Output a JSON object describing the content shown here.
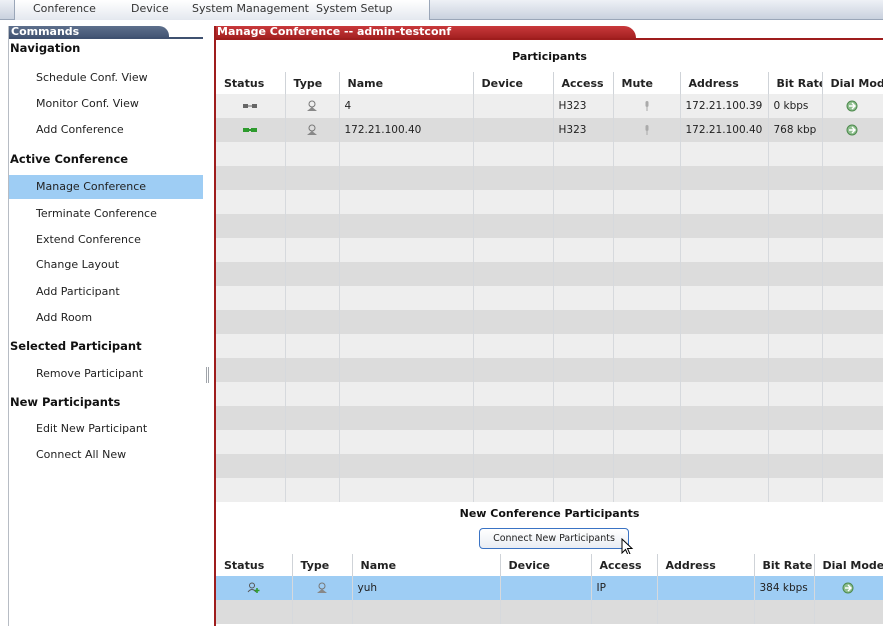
{
  "menubar": {
    "items": [
      "Conference",
      "Device",
      "System Management",
      "System Setup"
    ]
  },
  "commands": {
    "header": "Commands",
    "sections": [
      {
        "title": "Navigation",
        "items": [
          "Schedule Conf. View",
          "Monitor Conf. View",
          "Add Conference"
        ]
      },
      {
        "title": "Active Conference",
        "items": [
          "Manage Conference",
          "Terminate Conference",
          "Extend Conference",
          "Change Layout",
          "Add Participant",
          "Add Room"
        ]
      },
      {
        "title": "Selected Participant",
        "items": [
          "Remove Participant"
        ]
      },
      {
        "title": "New Participants",
        "items": [
          "Edit New Participant",
          "Connect All New"
        ]
      }
    ],
    "active_item": "Manage Conference"
  },
  "panel": {
    "title": "Manage Conference -- admin-testconf"
  },
  "participants": {
    "title": "Participants",
    "columns": [
      "Status",
      "Type",
      "Name",
      "Device",
      "Access",
      "Mute",
      "Address",
      "Bit Rate",
      "Dial Mod"
    ],
    "rows": [
      {
        "status_icon": "connecting-icon",
        "type_icon": "endpoint-icon",
        "name": "4",
        "device": "",
        "access": "H323",
        "mute_icon": "microphone-icon",
        "address": "172.21.100.39",
        "bitrate": "0 kbps",
        "dial_icon": "dial-out-icon"
      },
      {
        "status_icon": "connected-icon",
        "type_icon": "endpoint-icon",
        "name": "172.21.100.40",
        "device": "",
        "access": "H323",
        "mute_icon": "microphone-icon",
        "address": "172.21.100.40",
        "bitrate": "768 kbp",
        "dial_icon": "dial-out-icon"
      }
    ]
  },
  "new_participants": {
    "title": "New Conference Participants",
    "connect_button": "Connect New Participants",
    "columns": [
      "Status",
      "Type",
      "Name",
      "Device",
      "Access",
      "Address",
      "Bit Rate",
      "Dial Mode"
    ],
    "rows": [
      {
        "status_icon": "add-user-icon",
        "type_icon": "endpoint-icon",
        "name": "yuh",
        "device": "",
        "access": "IP",
        "address": "",
        "bitrate": "384 kbps",
        "dial_icon": "dial-out-icon"
      }
    ]
  },
  "colors": {
    "accent_red": "#9e1d1d",
    "header_blue": "#3f5170",
    "selection": "#9ecdf4",
    "status_green": "#2e9b2e"
  }
}
